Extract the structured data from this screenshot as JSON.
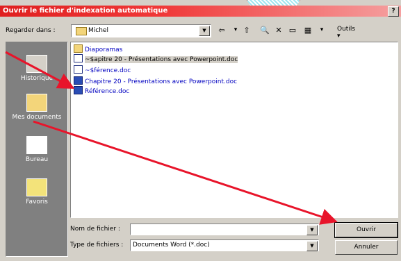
{
  "titlebar": {
    "title": "Ouvrir le fichier d'indexation automatique",
    "help": "?"
  },
  "look_in": {
    "label": "Regarder dans :",
    "value": "Michel"
  },
  "toolbar": {
    "outils_label": "Outils"
  },
  "places": [
    {
      "label": "Historique"
    },
    {
      "label": "Mes documents"
    },
    {
      "label": "Bureau"
    },
    {
      "label": "Favoris"
    }
  ],
  "files": [
    {
      "name": "Diaporamas",
      "kind": "folder"
    },
    {
      "name": "~$apitre 20 - Présentations avec Powerpoint.doc",
      "kind": "doc"
    },
    {
      "name": "~$férence.doc",
      "kind": "doc"
    },
    {
      "name": "Chapitre 20 - Présentations avec Powerpoint.doc",
      "kind": "word"
    },
    {
      "name": "Référence.doc",
      "kind": "word"
    }
  ],
  "filename": {
    "label": "Nom de fichier :",
    "value": ""
  },
  "filetype": {
    "label": "Type de fichiers :",
    "value": "Documents Word (*.doc)"
  },
  "buttons": {
    "open": "Ouvrir",
    "cancel": "Annuler"
  },
  "colors": {
    "title_bar": "#e02020",
    "annotation_arrow": "#e8142a"
  }
}
